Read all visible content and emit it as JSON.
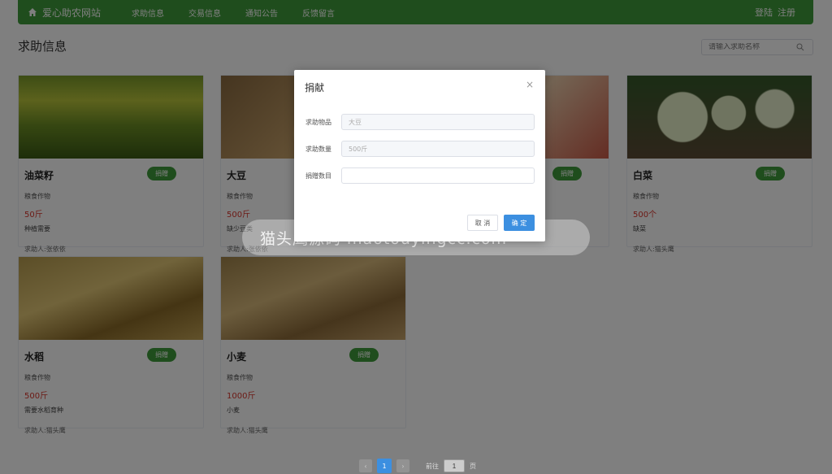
{
  "navbar": {
    "brand": "爱心助农网站",
    "links": [
      "求助信息",
      "交易信息",
      "通知公告",
      "反馈留言"
    ],
    "login": "登陆",
    "register": "注册"
  },
  "page": {
    "title": "求助信息",
    "search_placeholder": "请输入求助名称"
  },
  "cards": [
    {
      "name": "油菜籽",
      "category": "粮食作物",
      "quantity": "50斤",
      "desc": "种植需要",
      "requester": "求助人:张依依",
      "button": "捐赠"
    },
    {
      "name": "大豆",
      "category": "粮食作物",
      "quantity": "500斤",
      "desc": "缺少豆类",
      "requester": "求助人:张依依",
      "button": "捐赠"
    },
    {
      "name": "",
      "category": "",
      "quantity": "",
      "desc": "",
      "requester": "",
      "button": "捐赠"
    },
    {
      "name": "白菜",
      "category": "粮食作物",
      "quantity": "500个",
      "desc": "缺菜",
      "requester": "求助人:猫头鹰",
      "button": "捐赠"
    },
    {
      "name": "水稻",
      "category": "粮食作物",
      "quantity": "500斤",
      "desc": "需要水稻育种",
      "requester": "求助人:猫头鹰",
      "button": "捐赠"
    },
    {
      "name": "小麦",
      "category": "粮食作物",
      "quantity": "1000斤",
      "desc": "小麦",
      "requester": "求助人:猫头鹰",
      "button": "捐赠"
    }
  ],
  "modal": {
    "title": "捐献",
    "close": "×",
    "item_label": "求助物品",
    "item_value": "大豆",
    "qty_label": "求助数量",
    "qty_value": "500斤",
    "donate_label": "捐赠数目",
    "donate_value": "",
    "cancel": "取 消",
    "ok": "确 定"
  },
  "watermark": "猫头鹰源码 maotouyingcc.com",
  "pagination": {
    "current": "1",
    "goto_label": "前往",
    "goto_value": "1",
    "page_suffix": "页"
  },
  "colors": {
    "brand_green": "#3f9b3a",
    "primary_blue": "#3c8fe0",
    "price_red": "#d9342b"
  }
}
